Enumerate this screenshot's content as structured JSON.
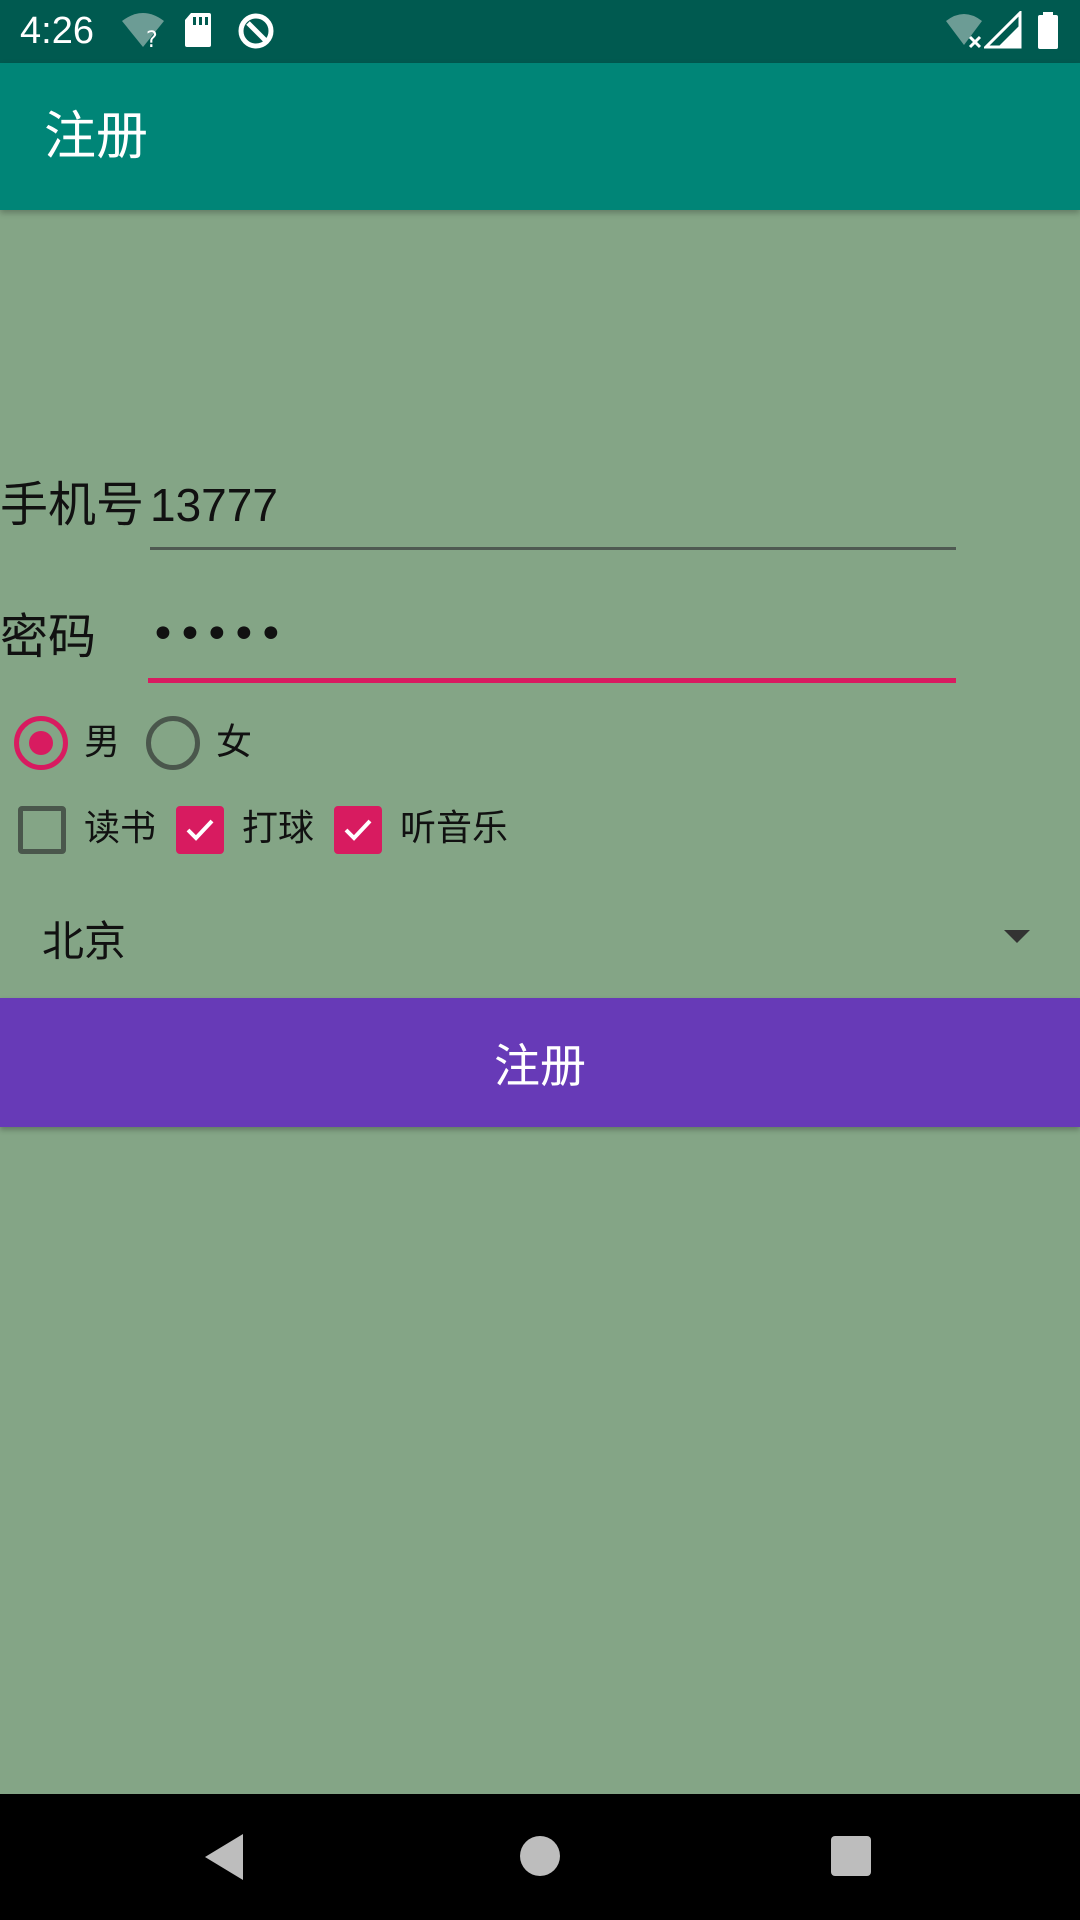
{
  "status_bar": {
    "time": "4:26",
    "icons": [
      "wifi-unknown-icon",
      "sd-card-icon",
      "data-saver-icon",
      "wifi-no-internet-icon",
      "cell-signal-icon",
      "battery-icon"
    ]
  },
  "app_bar": {
    "title": "注册"
  },
  "form": {
    "phone_label": "手机号",
    "phone_value": "13777",
    "password_label": "密码",
    "password_value": "•••••",
    "gender": {
      "options": [
        {
          "label": "男",
          "checked": true
        },
        {
          "label": "女",
          "checked": false
        }
      ]
    },
    "hobbies": [
      {
        "label": "读书",
        "checked": false
      },
      {
        "label": "打球",
        "checked": true
      },
      {
        "label": "听音乐",
        "checked": true
      }
    ],
    "city": {
      "selected": "北京"
    },
    "submit_label": "注册"
  },
  "colors": {
    "background": "#84a586",
    "status_bar": "#005a50",
    "app_bar": "#008577",
    "accent": "#d81b60",
    "button": "#673ab7"
  }
}
